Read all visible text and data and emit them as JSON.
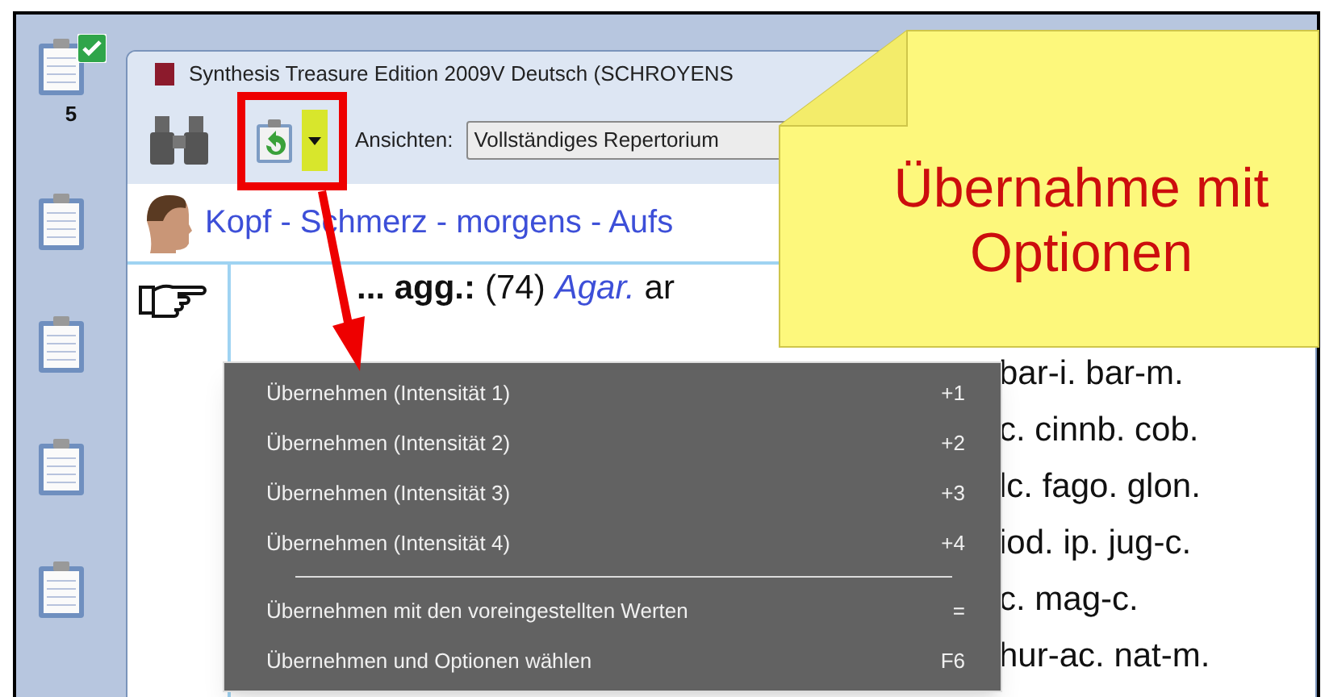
{
  "sidebar": {
    "items": [
      {
        "checked": true,
        "count": "5"
      },
      {
        "checked": false
      },
      {
        "checked": false
      },
      {
        "checked": false
      },
      {
        "checked": false
      }
    ]
  },
  "window": {
    "title": "Synthesis Treasure Edition 2009V Deutsch (SCHROYENS"
  },
  "toolbar": {
    "views_label": "Ansichten:",
    "views_value": "Vollständiges Repertorium"
  },
  "breadcrumb": "Kopf - Schmerz - morgens - Aufs",
  "content": {
    "first_line": [
      {
        "kind": "bold",
        "text": "... agg.:"
      },
      {
        "kind": "plain",
        "text": "(74)"
      },
      {
        "kind": "remedy",
        "text": "Agar."
      },
      {
        "kind": "plain",
        "text": "ar"
      }
    ],
    "lines": [
      "bar-i. bar-m.",
      "c. cinnb. cob.",
      "lc. fago. glon.",
      "iod. ip. jug-c.",
      "c. mag-c.",
      "hur-ac. nat-m."
    ]
  },
  "menu": [
    {
      "kind": "item",
      "label": "Übernehmen (Intensität 1)",
      "shortcut": "+1"
    },
    {
      "kind": "item",
      "label": "Übernehmen (Intensität 2)",
      "shortcut": "+2"
    },
    {
      "kind": "item",
      "label": "Übernehmen (Intensität 3)",
      "shortcut": "+3"
    },
    {
      "kind": "item",
      "label": "Übernehmen (Intensität 4)",
      "shortcut": "+4"
    },
    {
      "kind": "separator"
    },
    {
      "kind": "item",
      "label": "Übernehmen mit den voreingestellten Werten",
      "shortcut": "="
    },
    {
      "kind": "item",
      "label": "Übernehmen und Optionen wählen",
      "shortcut": "F6"
    }
  ],
  "callout": "Übernahme mit Optionen"
}
